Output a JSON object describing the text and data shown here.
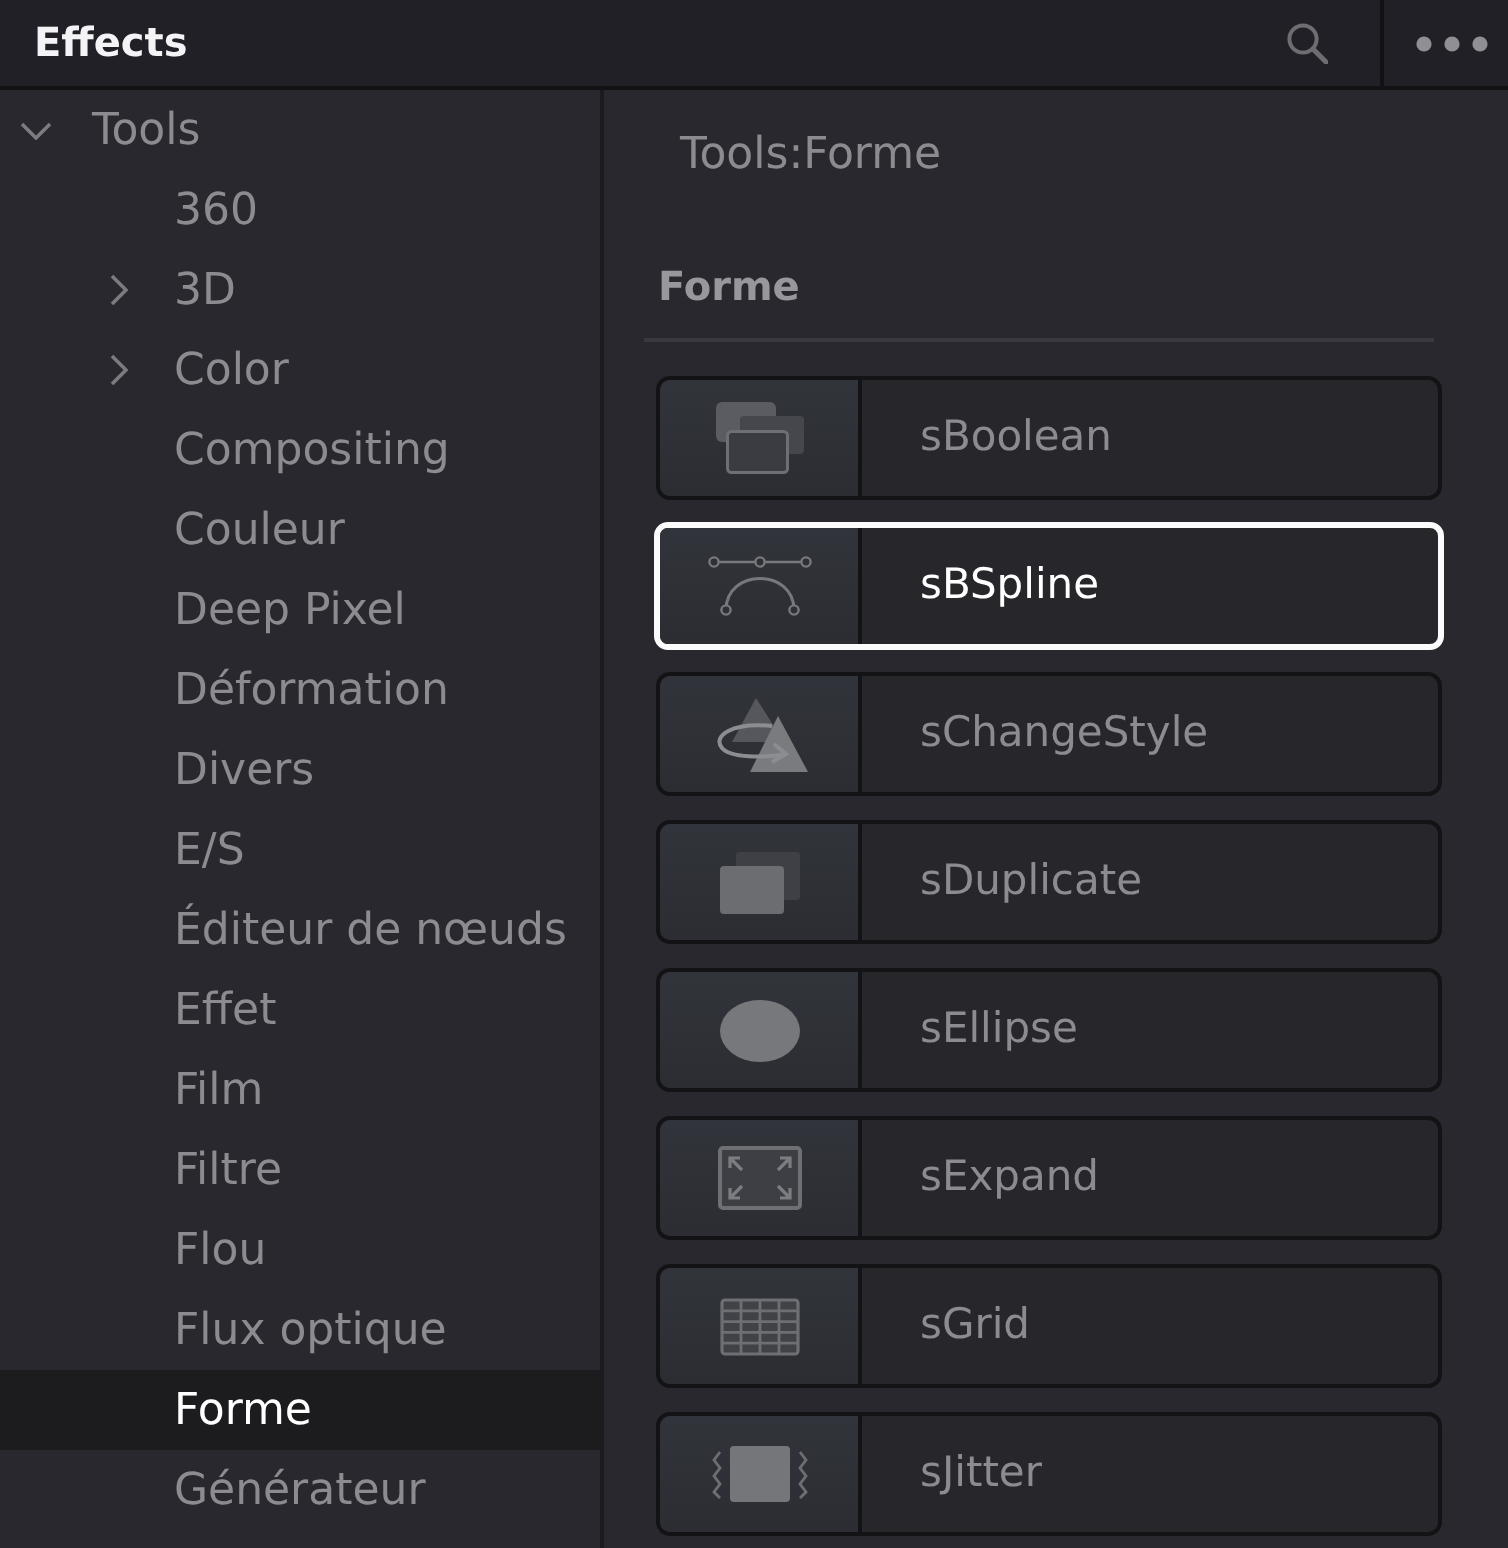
{
  "panel": {
    "title": "Effects"
  },
  "tree": [
    {
      "label": "Tools",
      "expanded": true,
      "selected": false,
      "children": [
        {
          "label": "360",
          "selected": false
        },
        {
          "label": "3D",
          "expanded": false,
          "selected": false
        },
        {
          "label": "Color",
          "expanded": false,
          "selected": false
        },
        {
          "label": "Compositing",
          "selected": false
        },
        {
          "label": "Couleur",
          "selected": false
        },
        {
          "label": "Deep Pixel",
          "selected": false
        },
        {
          "label": "Déformation",
          "selected": false
        },
        {
          "label": "Divers",
          "selected": false
        },
        {
          "label": "E/S",
          "selected": false
        },
        {
          "label": "Éditeur de nœuds",
          "selected": false
        },
        {
          "label": "Effet",
          "selected": false
        },
        {
          "label": "Film",
          "selected": false
        },
        {
          "label": "Filtre",
          "selected": false
        },
        {
          "label": "Flou",
          "selected": false
        },
        {
          "label": "Flux optique",
          "selected": false
        },
        {
          "label": "Forme",
          "selected": true
        },
        {
          "label": "Générateur",
          "selected": false
        }
      ]
    }
  ],
  "content": {
    "path": "Tools:Forme",
    "section": "Forme",
    "tools": [
      {
        "label": "sBoolean",
        "selected": false
      },
      {
        "label": "sBSpline",
        "selected": true
      },
      {
        "label": "sChangeStyle",
        "selected": false
      },
      {
        "label": "sDuplicate",
        "selected": false
      },
      {
        "label": "sEllipse",
        "selected": false
      },
      {
        "label": "sExpand",
        "selected": false
      },
      {
        "label": "sGrid",
        "selected": false
      },
      {
        "label": "sJitter",
        "selected": false
      }
    ]
  }
}
